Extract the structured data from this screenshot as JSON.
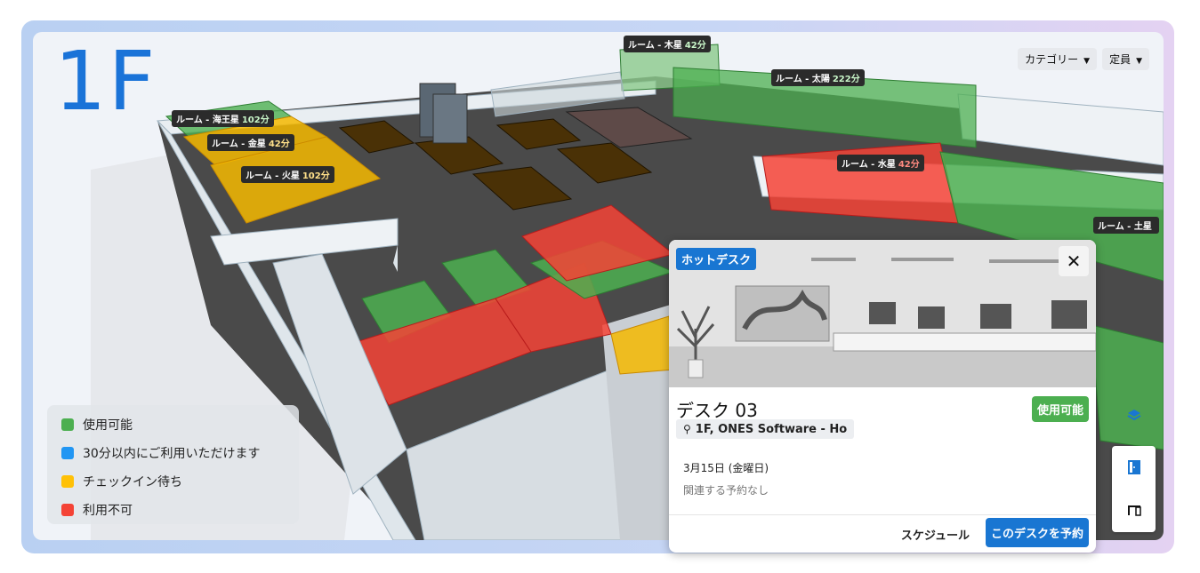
{
  "floor": {
    "title": "1F"
  },
  "filters": {
    "category_label": "カテゴリー",
    "capacity_label": "定員"
  },
  "rooms": [
    {
      "name": "ルーム - 木星",
      "time": "42分",
      "status": "available"
    },
    {
      "name": "ルーム - 太陽",
      "time": "222分",
      "status": "available"
    },
    {
      "name": "ルーム - 海王星",
      "time": "102分",
      "status": "available"
    },
    {
      "name": "ルーム - 金星",
      "time": "42分",
      "status": "pending"
    },
    {
      "name": "ルーム - 火星",
      "time": "102分",
      "status": "pending"
    },
    {
      "name": "ルーム - 水星",
      "time": "42分",
      "status": "unavailable"
    },
    {
      "name": "ルーム - 土星",
      "time": "",
      "status": "available"
    }
  ],
  "legend": [
    {
      "label": "使用可能",
      "color": "#4caf50"
    },
    {
      "label": "30分以内にご利用いただけます",
      "color": "#2196f3"
    },
    {
      "label": "チェックイン待ち",
      "color": "#ffc107"
    },
    {
      "label": "利用不可",
      "color": "#f44336"
    }
  ],
  "colors": {
    "available": "#4caf50",
    "pending": "#f5b800",
    "unavailable": "#f44336",
    "accent": "#1976d2"
  },
  "desk_card": {
    "type_badge": "ホットデスク",
    "title": "デスク 03",
    "status": "使用可能",
    "location": "1F, ONES Software - Ho",
    "date": "3月15日 (金曜日)",
    "reservations": "関連する予約なし",
    "schedule_label": "スケジュール",
    "reserve_label": "このデスクを予約"
  },
  "icons": [
    "layers-icon",
    "room-icon",
    "desk-icon",
    "close-icon",
    "location-pin-icon",
    "chevron-down-icon"
  ]
}
